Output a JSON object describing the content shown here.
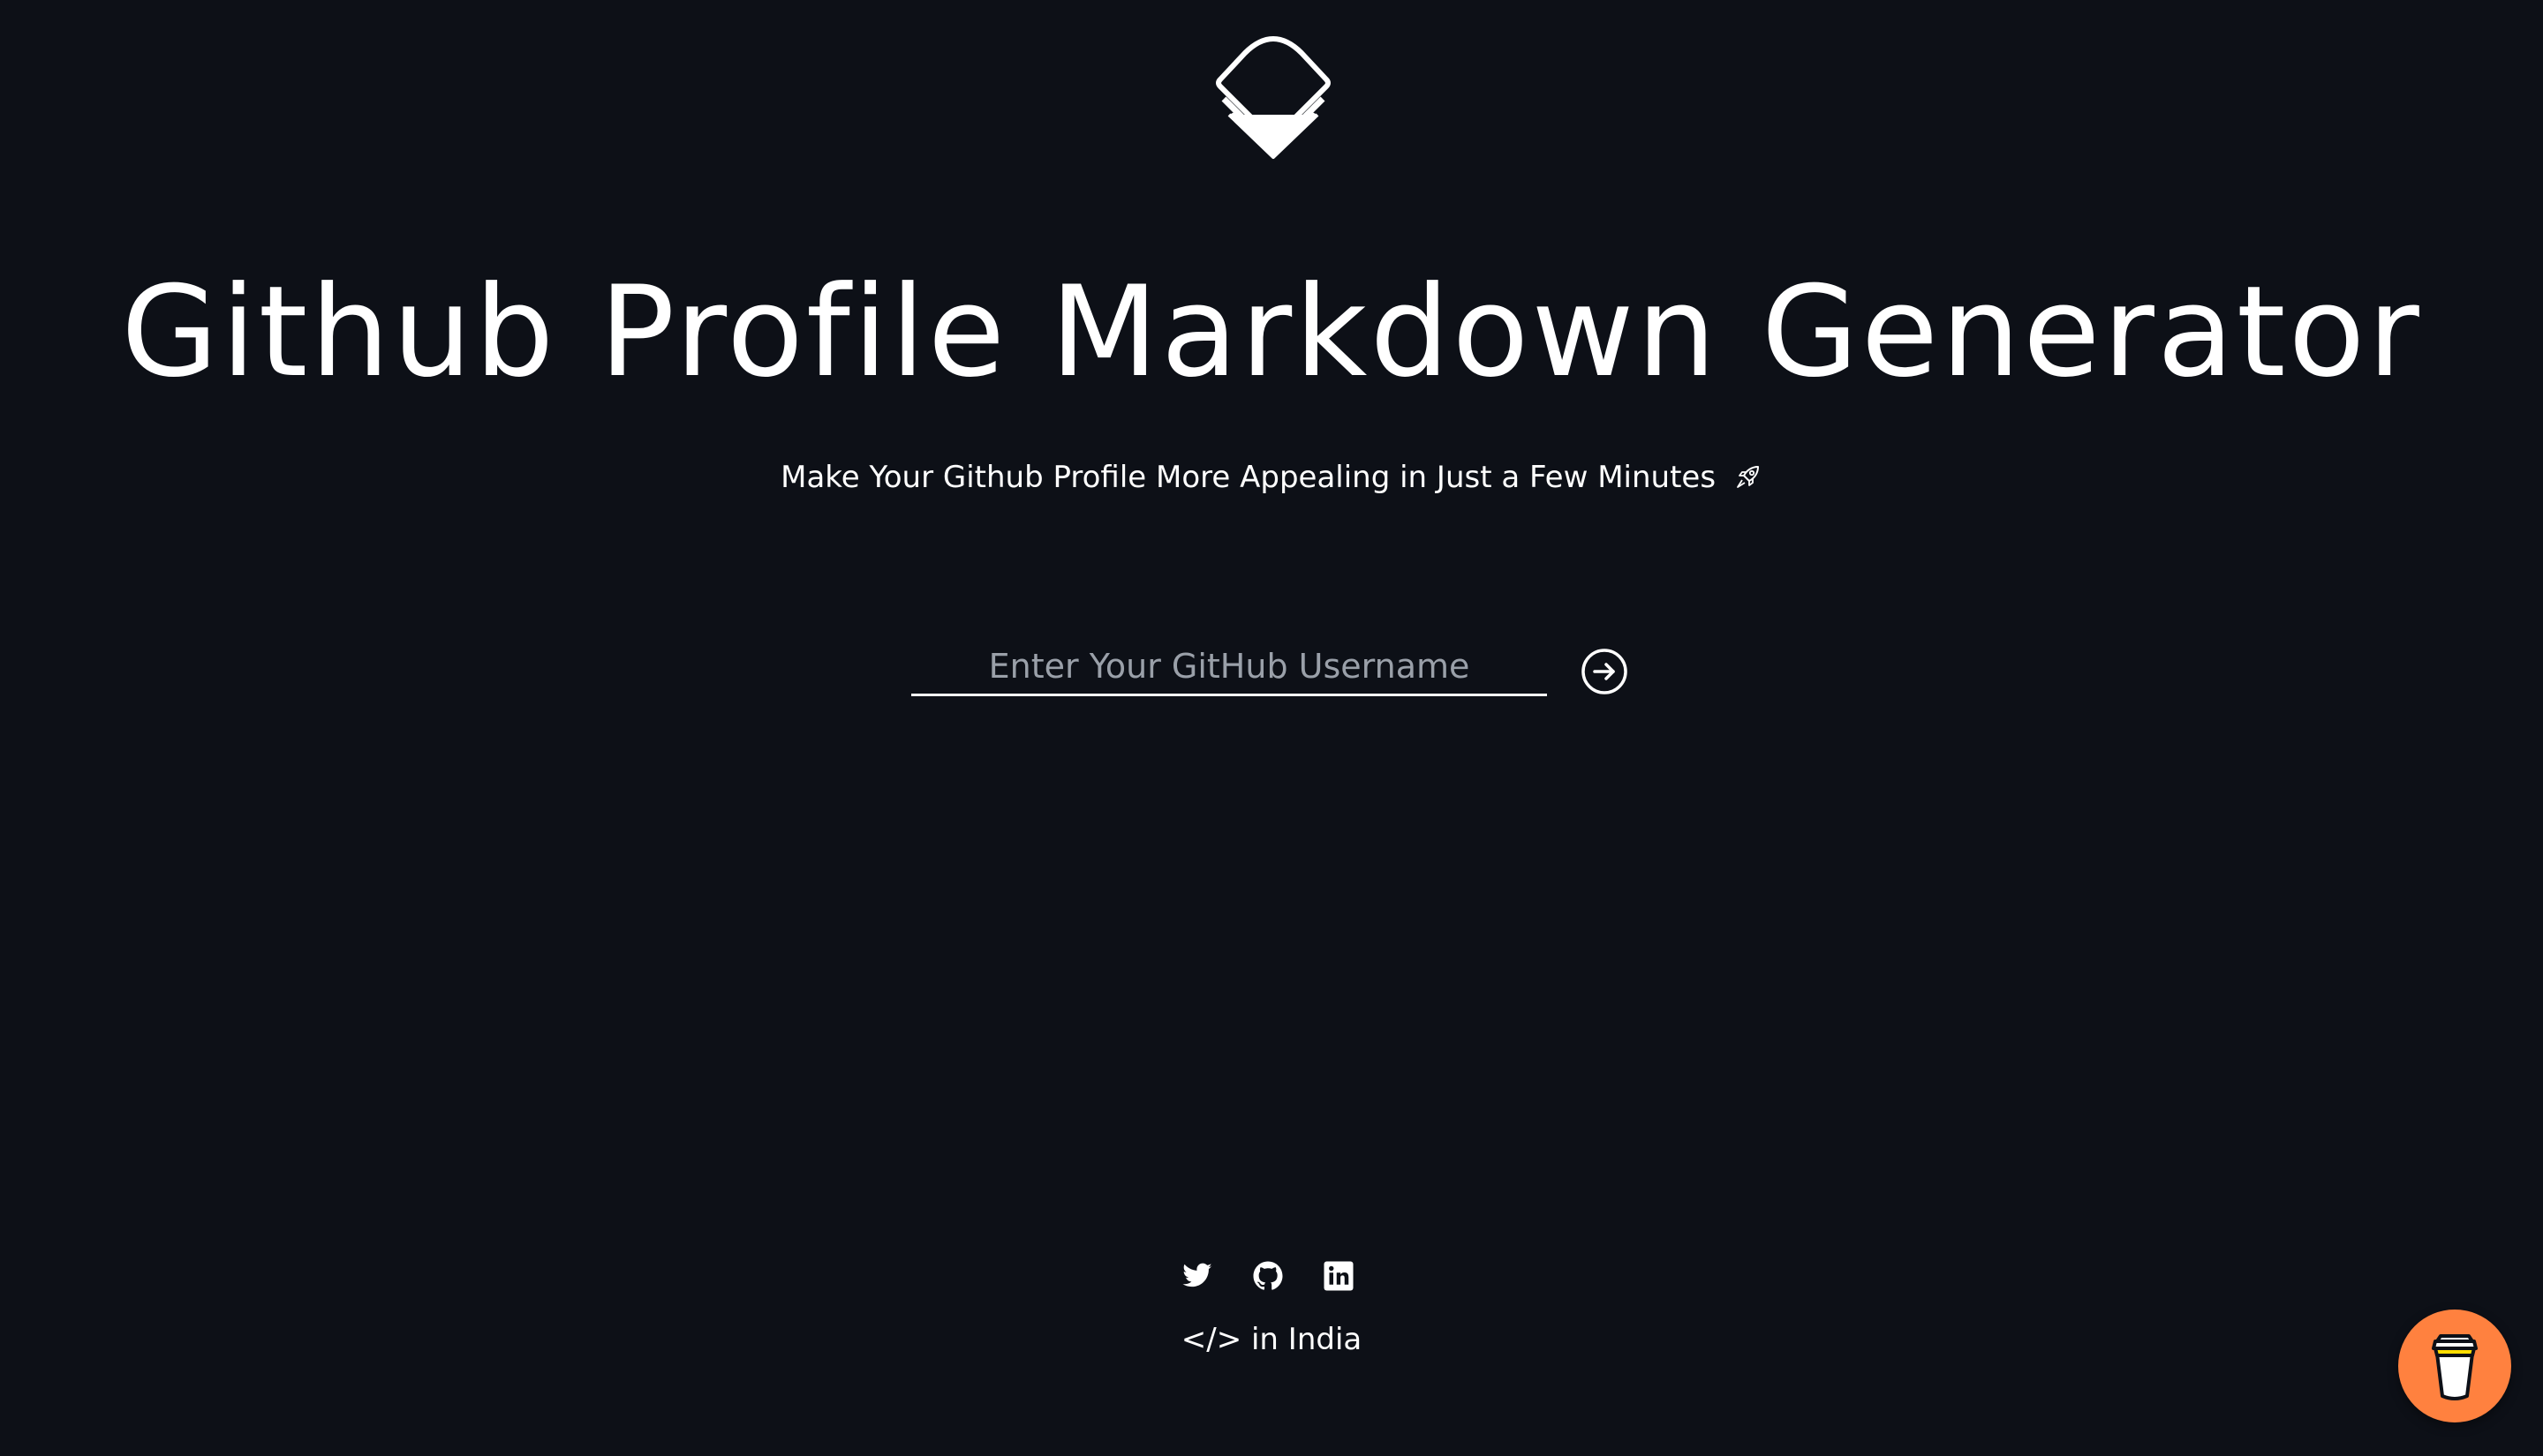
{
  "header": {
    "logo_icon": "layered-diamond-logo-icon"
  },
  "hero": {
    "title": "Github Profile Markdown Generator",
    "subtitle": "Make Your Github Profile More Appealing in Just a Few Minutes",
    "subtitle_icon": "rocket-icon"
  },
  "search": {
    "value": "",
    "placeholder": "Enter Your GitHub Username",
    "submit_icon": "arrow-right-circle-icon"
  },
  "footer": {
    "social_icons": [
      "twitter-icon",
      "github-icon",
      "linkedin-icon"
    ],
    "text": "</> in India"
  },
  "floating": {
    "icon": "coffee-cup-icon",
    "color": "#ff813f"
  },
  "colors": {
    "background": "#0d1017",
    "text": "#ffffff",
    "placeholder": "#9aa0a9"
  }
}
